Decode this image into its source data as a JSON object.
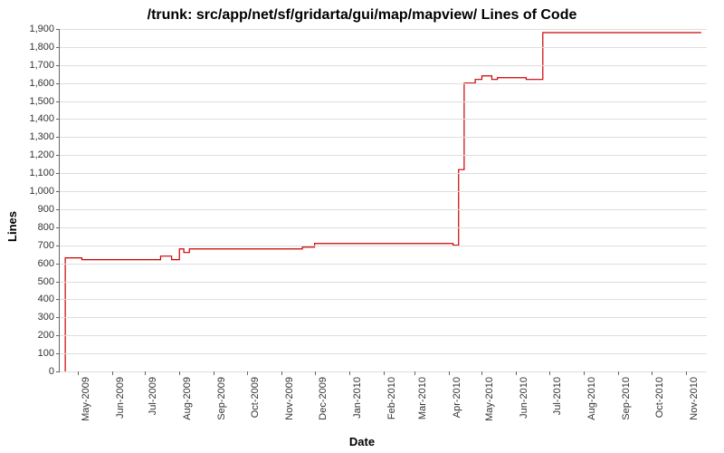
{
  "chart_data": {
    "type": "line",
    "title": "/trunk: src/app/net/sf/gridarta/gui/map/mapview/ Lines of Code",
    "xlabel": "Date",
    "ylabel": "Lines",
    "ylim": [
      0,
      1900
    ],
    "y_ticks": [
      0,
      100,
      200,
      300,
      400,
      500,
      600,
      700,
      800,
      900,
      1000,
      1100,
      1200,
      1300,
      1400,
      1500,
      1600,
      1700,
      1800,
      1900
    ],
    "y_tick_labels": [
      "0",
      "100",
      "200",
      "300",
      "400",
      "500",
      "600",
      "700",
      "800",
      "900",
      "1,000",
      "1,100",
      "1,200",
      "1,300",
      "1,400",
      "1,500",
      "1,600",
      "1,700",
      "1,800",
      "1,900"
    ],
    "x_ticks": [
      "May-2009",
      "Jun-2009",
      "Jul-2009",
      "Aug-2009",
      "Sep-2009",
      "Oct-2009",
      "Nov-2009",
      "Dec-2009",
      "Jan-2010",
      "Feb-2010",
      "Mar-2010",
      "Apr-2010",
      "May-2010",
      "Jun-2010",
      "Jul-2010",
      "Aug-2010",
      "Sep-2010",
      "Oct-2010",
      "Nov-2010"
    ],
    "series": [
      {
        "name": "Lines of Code",
        "color": "#cc0000",
        "points": [
          {
            "x": "2009-04-20",
            "y": 0
          },
          {
            "x": "2009-04-20",
            "y": 630
          },
          {
            "x": "2009-05-05",
            "y": 630
          },
          {
            "x": "2009-05-05",
            "y": 620
          },
          {
            "x": "2009-07-15",
            "y": 620
          },
          {
            "x": "2009-07-15",
            "y": 640
          },
          {
            "x": "2009-07-25",
            "y": 640
          },
          {
            "x": "2009-07-25",
            "y": 620
          },
          {
            "x": "2009-08-01",
            "y": 620
          },
          {
            "x": "2009-08-01",
            "y": 680
          },
          {
            "x": "2009-08-05",
            "y": 680
          },
          {
            "x": "2009-08-05",
            "y": 660
          },
          {
            "x": "2009-08-10",
            "y": 660
          },
          {
            "x": "2009-08-10",
            "y": 680
          },
          {
            "x": "2009-11-20",
            "y": 680
          },
          {
            "x": "2009-11-20",
            "y": 690
          },
          {
            "x": "2009-12-01",
            "y": 690
          },
          {
            "x": "2009-12-01",
            "y": 710
          },
          {
            "x": "2010-04-05",
            "y": 710
          },
          {
            "x": "2010-04-05",
            "y": 700
          },
          {
            "x": "2010-04-10",
            "y": 700
          },
          {
            "x": "2010-04-10",
            "y": 1120
          },
          {
            "x": "2010-04-15",
            "y": 1120
          },
          {
            "x": "2010-04-15",
            "y": 1600
          },
          {
            "x": "2010-04-25",
            "y": 1600
          },
          {
            "x": "2010-04-25",
            "y": 1620
          },
          {
            "x": "2010-05-01",
            "y": 1620
          },
          {
            "x": "2010-05-01",
            "y": 1640
          },
          {
            "x": "2010-05-10",
            "y": 1640
          },
          {
            "x": "2010-05-10",
            "y": 1620
          },
          {
            "x": "2010-05-15",
            "y": 1620
          },
          {
            "x": "2010-05-15",
            "y": 1630
          },
          {
            "x": "2010-06-10",
            "y": 1630
          },
          {
            "x": "2010-06-10",
            "y": 1620
          },
          {
            "x": "2010-06-25",
            "y": 1620
          },
          {
            "x": "2010-06-25",
            "y": 1880
          },
          {
            "x": "2010-11-15",
            "y": 1880
          }
        ]
      }
    ],
    "x_range": [
      "2009-04-15",
      "2010-11-20"
    ]
  }
}
